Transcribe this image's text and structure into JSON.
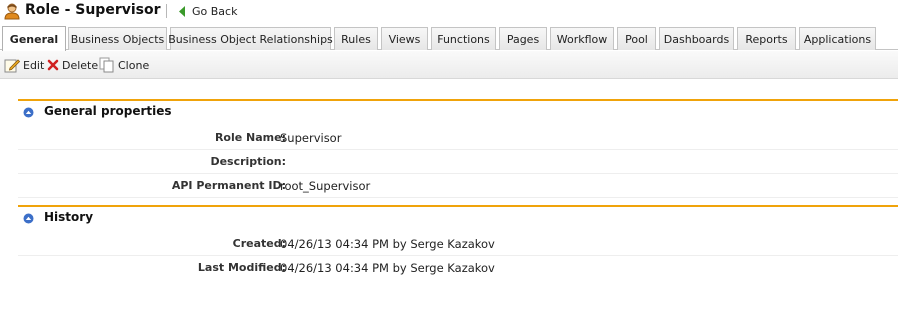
{
  "header": {
    "title": "Role - Supervisor",
    "role_icon": "user-role-icon",
    "go_back_label": "Go Back",
    "go_back_icon": "green-left-arrow-icon"
  },
  "tabs": [
    {
      "label": "General",
      "active": true
    },
    {
      "label": "Business Objects"
    },
    {
      "label": "Business Object Relationships"
    },
    {
      "label": "Rules"
    },
    {
      "label": "Views"
    },
    {
      "label": "Functions"
    },
    {
      "label": "Pages"
    },
    {
      "label": "Workflow"
    },
    {
      "label": "Pool"
    },
    {
      "label": "Dashboards"
    },
    {
      "label": "Reports"
    },
    {
      "label": "Applications"
    }
  ],
  "toolbar": {
    "edit_label": "Edit",
    "delete_label": "Delete",
    "clone_label": "Clone"
  },
  "general": {
    "title": "General properties",
    "fields": [
      {
        "label": "Role Name:",
        "value": "Supervisor"
      },
      {
        "label": "Description:",
        "value": ""
      },
      {
        "label": "API Permanent ID:",
        "value": "root_Supervisor"
      }
    ]
  },
  "history": {
    "title": "History",
    "fields": [
      {
        "label": "Created:",
        "value": "04/26/13 04:34 PM by Serge Kazakov"
      },
      {
        "label": "Last Modified:",
        "value": "04/26/13 04:34 PM by Serge Kazakov"
      }
    ]
  },
  "colors": {
    "section_accent": "#f0a30a",
    "toggle_blue": "#3c6fc8",
    "back_arrow_green": "#3a9a2a",
    "delete_red": "#d02020"
  }
}
